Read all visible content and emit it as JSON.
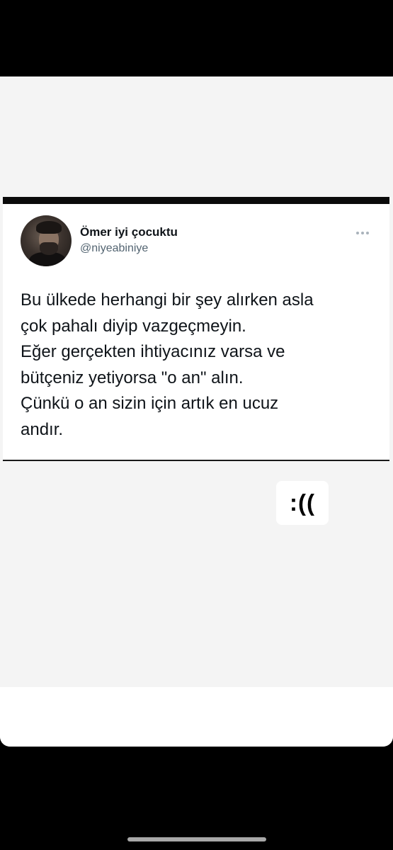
{
  "tweet": {
    "display_name": "Ömer iyi çocuktu",
    "handle": "@niyeabiniye",
    "more_icon": "more-horizontal-icon",
    "lines": [
      "Bu ülkede herhangi bir şey alırken asla",
      "çok pahalı diyip vazgeçmeyin.",
      "Eğer gerçekten ihtiyacınız varsa ve",
      "bütçeniz yetiyorsa \"o an\" alın.",
      "Çünkü o an sizin için artık en ucuz",
      "andır."
    ]
  },
  "sticker": {
    "text": ":(("
  },
  "colors": {
    "background": "#000000",
    "story_background": "#f4f4f4",
    "text": "#0f1419",
    "handle": "#536471"
  }
}
